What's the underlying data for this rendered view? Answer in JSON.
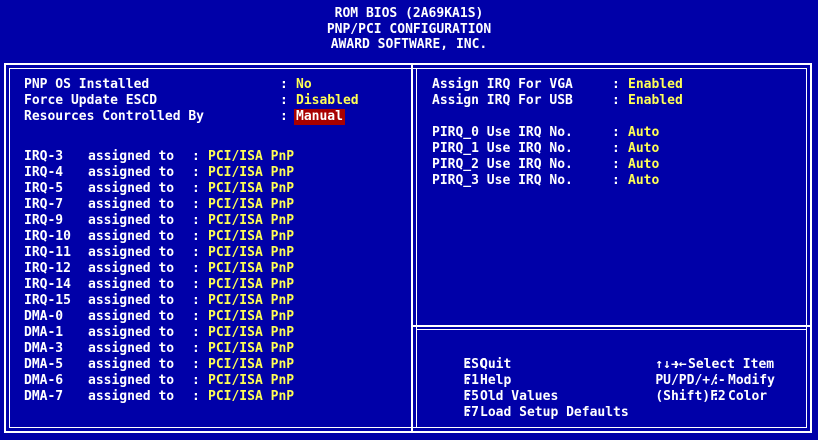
{
  "header": {
    "line1": "ROM  BIOS (2A69KA1S)",
    "line2": "PNP/PCI CONFIGURATION",
    "line3": "AWARD SOFTWARE, INC."
  },
  "left": {
    "top_items": [
      {
        "label": "PNP OS Installed",
        "value": "No",
        "selected": false
      },
      {
        "label": "Force Update ESCD",
        "value": "Disabled",
        "selected": false
      },
      {
        "label": "Resources Controlled By",
        "value": "Manual",
        "selected": true
      }
    ],
    "assigned_to_text": "assigned to",
    "irq_items": [
      {
        "label": "IRQ-3",
        "value": "PCI/ISA PnP"
      },
      {
        "label": "IRQ-4",
        "value": "PCI/ISA PnP"
      },
      {
        "label": "IRQ-5",
        "value": "PCI/ISA PnP"
      },
      {
        "label": "IRQ-7",
        "value": "PCI/ISA PnP"
      },
      {
        "label": "IRQ-9",
        "value": "PCI/ISA PnP"
      },
      {
        "label": "IRQ-10",
        "value": "PCI/ISA PnP"
      },
      {
        "label": "IRQ-11",
        "value": "PCI/ISA PnP"
      },
      {
        "label": "IRQ-12",
        "value": "PCI/ISA PnP"
      },
      {
        "label": "IRQ-14",
        "value": "PCI/ISA PnP"
      },
      {
        "label": "IRQ-15",
        "value": "PCI/ISA PnP"
      },
      {
        "label": "DMA-0",
        "value": "PCI/ISA PnP"
      },
      {
        "label": "DMA-1",
        "value": "PCI/ISA PnP"
      },
      {
        "label": "DMA-3",
        "value": "PCI/ISA PnP"
      },
      {
        "label": "DMA-5",
        "value": "PCI/ISA PnP"
      },
      {
        "label": "DMA-6",
        "value": "PCI/ISA PnP"
      },
      {
        "label": "DMA-7",
        "value": "PCI/ISA PnP"
      }
    ]
  },
  "right": {
    "items": [
      {
        "label": "Assign IRQ For VGA",
        "value": "Enabled"
      },
      {
        "label": "Assign IRQ For USB",
        "value": "Enabled"
      },
      {
        "label": "PIRQ_0 Use IRQ No.",
        "value": "Auto"
      },
      {
        "label": "PIRQ_1 Use IRQ No.",
        "value": "Auto"
      },
      {
        "label": "PIRQ_2 Use IRQ No.",
        "value": "Auto"
      },
      {
        "label": "PIRQ_3 Use IRQ No.",
        "value": "Auto"
      }
    ]
  },
  "help": {
    "esc": {
      "key": "ESC",
      "action": "Quit"
    },
    "f1": {
      "key": "F1",
      "action": "Help"
    },
    "f5": {
      "key": "F5",
      "action": "Old Values"
    },
    "f7": {
      "key": "F7",
      "action": "Load Setup Defaults"
    },
    "arrows": {
      "key": "↑↓→←",
      "action": "Select Item"
    },
    "pupd": {
      "key": "PU/PD/+/-",
      "action": "Modify"
    },
    "shiftf2": {
      "key": "(Shift)F2",
      "action": "Color"
    }
  },
  "colors": {
    "background": "#0000a8",
    "text": "#ffffff",
    "value": "#ffff54",
    "selection": "#a80000"
  }
}
